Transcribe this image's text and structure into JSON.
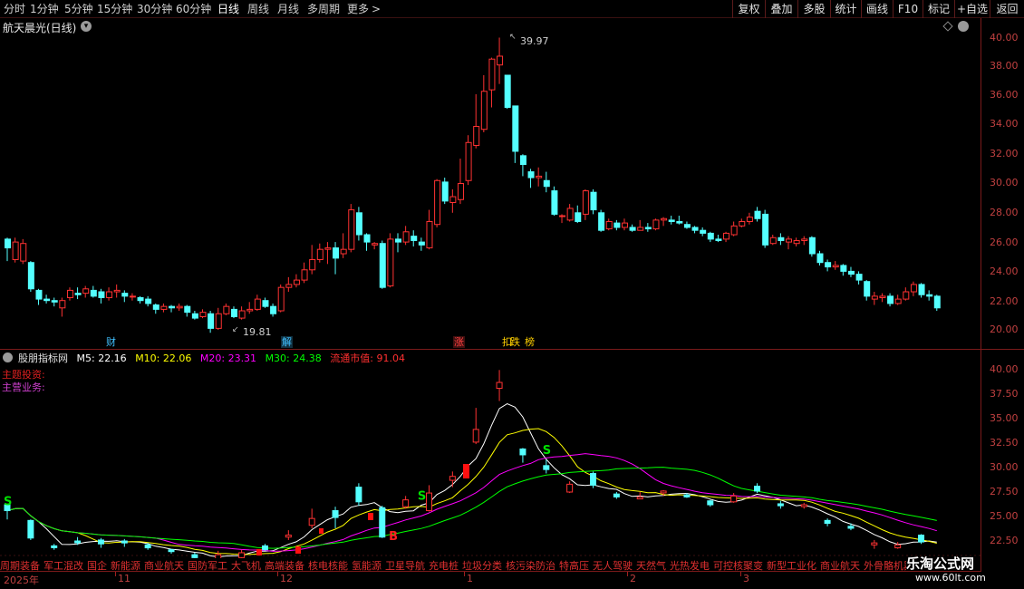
{
  "toolbar": {
    "timeframes": [
      "分时",
      "1分钟",
      "5分钟",
      "15分钟",
      "30分钟",
      "60分钟",
      "日线",
      "周线",
      "月线",
      "多周期",
      "更多"
    ],
    "active_timeframe": "日线",
    "more_glyph": ">",
    "right_buttons": [
      "复权",
      "叠加",
      "多股",
      "统计",
      "画线",
      "F10",
      "标记",
      "+自选",
      "返回"
    ]
  },
  "stock": {
    "title": "航天晨光(日线)"
  },
  "price_axis": [
    "40.00",
    "38.00",
    "36.00",
    "34.00",
    "32.00",
    "30.00",
    "28.00",
    "26.00",
    "24.00",
    "22.00",
    "20.00"
  ],
  "annotations": {
    "high": "39.97",
    "low": "19.81"
  },
  "events": [
    {
      "label": "财",
      "color": "#40c0ff"
    },
    {
      "label": "解",
      "color": "#40c0ff"
    },
    {
      "label": "涨",
      "color": "#ff4040"
    },
    {
      "label": "扣",
      "color": "#ffd000"
    },
    {
      "label": "跌",
      "color": "#ffd000"
    },
    {
      "label": "榜",
      "color": "#ffd000"
    }
  ],
  "indicator": {
    "name": "股朋指标网",
    "m5": "M5: 22.16",
    "m10": "M10: 22.06",
    "m20": "M20: 23.31",
    "m30": "M30: 24.38",
    "mcap": "流通市值: 91.04",
    "theme_label": "主题投资:",
    "biz_label": "主营业务:",
    "signals": {
      "s": "S",
      "b": "B"
    }
  },
  "indicator_axis": [
    "40.00",
    "37.50",
    "35.00",
    "32.50",
    "30.00",
    "27.50",
    "25.00",
    "22.50"
  ],
  "concepts": [
    "周期装备",
    "军工混改",
    "国企",
    "新能源",
    "商业航天",
    "国防军工",
    "大飞机",
    "高端装备",
    "核电核能",
    "氢能源",
    "卫星导航",
    "充电桩",
    "垃圾分类",
    "核污染防治",
    "特高压",
    "无人驾驶",
    "天然气",
    "光热发电",
    "可控核聚变",
    "新型工业化",
    "商业航天",
    "外骨骼机器人"
  ],
  "date_axis": {
    "year": "2025年",
    "months": [
      "11",
      "12",
      "1",
      "2",
      "3"
    ]
  },
  "watermark": {
    "title": "乐淘公式网",
    "url": "www.60lt.com"
  },
  "colors": {
    "up": "#ff3232",
    "down": "#54ffff",
    "m5": "#ffffff",
    "m10": "#ffff00",
    "m20": "#ff00ff",
    "m30": "#00ff00",
    "axis": "#7a1a1a"
  },
  "candles": [
    [
      26.2,
      25.6,
      26.3,
      24.7
    ],
    [
      24.8,
      26.0,
      26.3,
      24.6
    ],
    [
      24.7,
      25.9,
      26.2,
      24.5
    ],
    [
      24.6,
      22.8,
      24.7,
      22.6
    ],
    [
      22.7,
      22.1,
      22.8,
      21.7
    ],
    [
      22.1,
      22.0,
      22.4,
      21.8
    ],
    [
      22.0,
      21.9,
      22.2,
      21.6
    ],
    [
      21.5,
      22.0,
      22.2,
      20.9
    ],
    [
      22.2,
      22.7,
      22.9,
      22.0
    ],
    [
      22.5,
      22.4,
      22.9,
      22.1
    ],
    [
      22.5,
      22.8,
      23.0,
      22.2
    ],
    [
      22.7,
      22.3,
      23.0,
      22.2
    ],
    [
      22.6,
      22.2,
      22.8,
      21.8
    ],
    [
      22.2,
      22.6,
      22.9,
      22.0
    ],
    [
      22.6,
      22.7,
      23.1,
      22.2
    ],
    [
      22.5,
      22.3,
      22.7,
      21.9
    ],
    [
      22.3,
      22.3,
      22.5,
      22.0
    ],
    [
      22.2,
      22.0,
      22.3,
      21.8
    ],
    [
      22.1,
      21.8,
      22.3,
      21.6
    ],
    [
      21.7,
      21.4,
      21.8,
      21.1
    ],
    [
      21.4,
      21.6,
      21.8,
      21.2
    ],
    [
      21.6,
      21.5,
      21.7,
      21.2
    ],
    [
      21.5,
      21.6,
      21.8,
      21.3
    ],
    [
      21.6,
      21.2,
      21.7,
      20.9
    ],
    [
      21.1,
      20.8,
      21.3,
      20.7
    ],
    [
      20.9,
      21.2,
      21.4,
      20.8
    ],
    [
      21.1,
      20.1,
      21.3,
      19.8
    ],
    [
      20.1,
      21.1,
      21.5,
      20.0
    ],
    [
      21.1,
      21.6,
      21.8,
      21.0
    ],
    [
      21.4,
      20.9,
      21.6,
      20.8
    ],
    [
      20.8,
      21.3,
      21.6,
      20.7
    ],
    [
      21.3,
      21.4,
      21.9,
      21.1
    ],
    [
      21.4,
      22.1,
      22.4,
      21.3
    ],
    [
      22.0,
      21.6,
      22.2,
      21.5
    ],
    [
      21.6,
      21.1,
      21.8,
      20.9
    ],
    [
      21.3,
      22.9,
      23.1,
      21.2
    ],
    [
      22.9,
      23.1,
      23.6,
      22.6
    ],
    [
      23.1,
      23.4,
      23.8,
      22.9
    ],
    [
      23.4,
      24.1,
      24.6,
      23.2
    ],
    [
      24.1,
      24.8,
      25.8,
      23.8
    ],
    [
      24.8,
      25.5,
      25.9,
      24.6
    ],
    [
      25.5,
      25.6,
      26.0,
      24.5
    ],
    [
      25.6,
      24.9,
      26.0,
      23.8
    ],
    [
      25.2,
      25.5,
      26.6,
      24.9
    ],
    [
      25.5,
      28.2,
      28.6,
      25.3
    ],
    [
      28.0,
      26.5,
      28.4,
      26.1
    ],
    [
      26.5,
      26.0,
      26.6,
      25.4
    ],
    [
      25.8,
      25.9,
      26.0,
      25.5
    ],
    [
      25.9,
      22.9,
      26.1,
      22.8
    ],
    [
      23.0,
      26.2,
      26.6,
      22.9
    ],
    [
      26.2,
      26.0,
      26.6,
      25.3
    ],
    [
      26.0,
      26.7,
      27.1,
      25.8
    ],
    [
      26.4,
      26.1,
      26.8,
      25.7
    ],
    [
      26.0,
      25.8,
      26.3,
      25.4
    ],
    [
      25.6,
      27.4,
      28.2,
      25.5
    ],
    [
      27.2,
      30.2,
      30.3,
      27.0
    ],
    [
      30.1,
      28.8,
      30.4,
      28.6
    ],
    [
      28.7,
      29.1,
      29.6,
      28.0
    ],
    [
      28.9,
      30.0,
      31.7,
      28.6
    ],
    [
      30.2,
      32.8,
      33.3,
      29.9
    ],
    [
      32.6,
      33.9,
      36.1,
      32.4
    ],
    [
      33.7,
      36.3,
      37.4,
      33.5
    ],
    [
      36.4,
      38.5,
      38.6,
      35.2
    ],
    [
      38.1,
      38.7,
      39.97,
      36.8
    ],
    [
      37.4,
      35.2,
      37.4,
      35.1
    ],
    [
      35.3,
      32.2,
      33.8,
      31.4
    ],
    [
      31.9,
      31.3,
      32.0,
      30.5
    ],
    [
      30.8,
      30.4,
      31.0,
      29.7
    ],
    [
      30.4,
      30.5,
      31.1,
      29.8
    ],
    [
      30.2,
      29.8,
      30.8,
      29.4
    ],
    [
      29.5,
      27.9,
      29.8,
      27.8
    ],
    [
      27.8,
      27.8,
      27.9,
      27.3
    ],
    [
      27.5,
      28.3,
      28.6,
      27.4
    ],
    [
      28.0,
      27.4,
      28.5,
      27.3
    ],
    [
      27.9,
      29.5,
      29.6,
      27.5
    ],
    [
      29.4,
      28.2,
      29.6,
      27.9
    ],
    [
      28.0,
      26.8,
      28.2,
      26.7
    ],
    [
      26.9,
      27.4,
      27.6,
      26.8
    ],
    [
      27.3,
      27.0,
      27.5,
      26.8
    ],
    [
      27.0,
      27.3,
      27.6,
      26.8
    ],
    [
      27.0,
      26.8,
      27.2,
      26.7
    ],
    [
      26.8,
      27.0,
      27.5,
      26.8
    ],
    [
      27.0,
      26.9,
      27.3,
      26.7
    ],
    [
      26.9,
      27.5,
      27.6,
      26.8
    ],
    [
      27.5,
      27.6,
      27.7,
      27.1
    ],
    [
      27.5,
      27.4,
      27.8,
      27.2
    ],
    [
      27.4,
      27.3,
      27.8,
      27.2
    ],
    [
      27.2,
      27.0,
      27.4,
      26.9
    ],
    [
      27.0,
      26.8,
      27.1,
      26.6
    ],
    [
      26.8,
      26.6,
      27.0,
      26.4
    ],
    [
      26.6,
      26.2,
      26.7,
      26.0
    ],
    [
      26.2,
      26.1,
      26.5,
      26.0
    ],
    [
      26.2,
      26.6,
      26.7,
      26.0
    ],
    [
      26.5,
      27.1,
      27.4,
      26.4
    ],
    [
      27.1,
      27.4,
      27.6,
      27.0
    ],
    [
      27.4,
      27.7,
      28.0,
      27.2
    ],
    [
      28.1,
      27.6,
      28.4,
      27.4
    ],
    [
      27.9,
      25.8,
      28.2,
      25.6
    ],
    [
      25.9,
      26.3,
      26.5,
      25.8
    ],
    [
      26.3,
      26.1,
      26.6,
      25.8
    ],
    [
      26.0,
      26.2,
      26.4,
      25.5
    ],
    [
      25.9,
      26.1,
      26.3,
      25.7
    ],
    [
      26.1,
      26.2,
      26.4,
      25.8
    ],
    [
      26.3,
      25.2,
      26.4,
      25.0
    ],
    [
      25.2,
      24.6,
      25.4,
      24.4
    ],
    [
      24.6,
      24.3,
      24.8,
      24.0
    ],
    [
      24.3,
      24.4,
      24.7,
      24.1
    ],
    [
      24.4,
      24.0,
      24.5,
      23.7
    ],
    [
      24.0,
      23.8,
      24.3,
      23.6
    ],
    [
      23.8,
      23.4,
      24.0,
      23.1
    ],
    [
      23.3,
      22.3,
      23.4,
      22.0
    ],
    [
      22.1,
      22.3,
      22.6,
      21.7
    ],
    [
      22.2,
      22.3,
      22.5,
      21.9
    ],
    [
      22.3,
      21.8,
      22.5,
      21.6
    ],
    [
      21.8,
      22.1,
      22.4,
      21.7
    ],
    [
      22.1,
      22.6,
      22.9,
      22.0
    ],
    [
      22.6,
      23.1,
      23.3,
      22.3
    ],
    [
      23.1,
      22.4,
      23.2,
      22.2
    ],
    [
      22.4,
      22.3,
      22.7,
      22.0
    ],
    [
      22.3,
      21.5,
      22.4,
      21.3
    ]
  ],
  "indicator_marks": [
    {
      "kind": "S",
      "index": 0
    },
    {
      "kind": "S",
      "index": 53
    },
    {
      "kind": "S",
      "index": 69
    },
    {
      "kind": "B",
      "index": 55
    }
  ]
}
